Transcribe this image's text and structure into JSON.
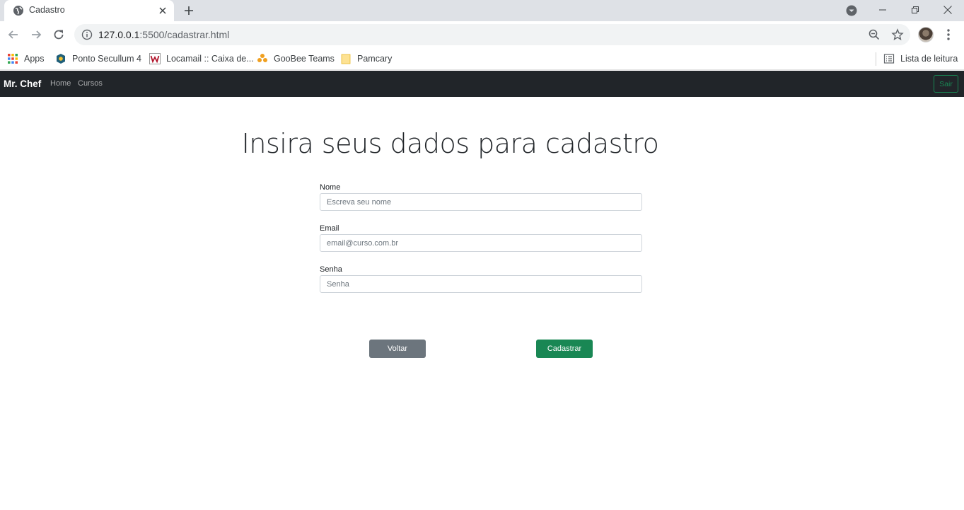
{
  "browser": {
    "tab_title": "Cadastro",
    "url_host": "127.0.0.1",
    "url_path": ":5500/cadastrar.html",
    "bookmarks": [
      {
        "label": "Apps",
        "icon": "apps-grid-icon"
      },
      {
        "label": "Ponto Secullum 4",
        "icon": "secullum-icon"
      },
      {
        "label": "Locamail :: Caixa de...",
        "icon": "locamail-icon"
      },
      {
        "label": "GooBee Teams",
        "icon": "goobee-icon"
      },
      {
        "label": "Pamcary",
        "icon": "folder-icon"
      }
    ],
    "reading_list": "Lista de leitura"
  },
  "navbar": {
    "brand": "Mr. Chef",
    "links": [
      "Home",
      "Cursos"
    ],
    "logout_label": "Sair"
  },
  "page": {
    "title": "Insira seus dados para cadastro",
    "fields": [
      {
        "label": "Nome",
        "placeholder": "Escreva seu nome",
        "value": ""
      },
      {
        "label": "Email",
        "placeholder": "email@curso.com.br",
        "value": ""
      },
      {
        "label": "Senha",
        "placeholder": "Senha",
        "value": ""
      }
    ],
    "back_label": "Voltar",
    "submit_label": "Cadastrar"
  },
  "colors": {
    "navbar_bg": "#212529",
    "success": "#198754",
    "secondary": "#6c757d"
  }
}
